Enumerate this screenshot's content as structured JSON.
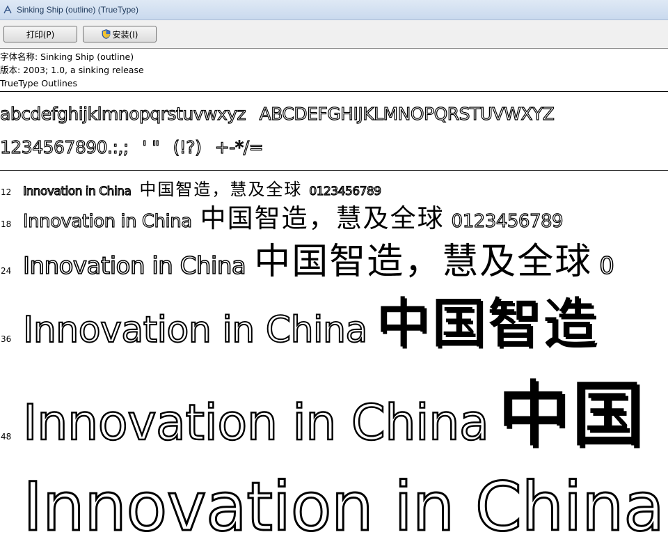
{
  "window": {
    "title": "Sinking Ship (outline) (TrueType)",
    "icon": "font-viewer-icon"
  },
  "toolbar": {
    "print_label": "打印(P)",
    "install_label": "安装(I)",
    "install_icon": "uac-shield-icon"
  },
  "info": {
    "font_name": "字体名称: Sinking Ship (outline)",
    "version": "版本: 2003; 1.0, a sinking release",
    "outline_type": "TrueType Outlines"
  },
  "charset": {
    "lowercase": "abcdefghijklmnopqrstuvwxyz",
    "uppercase": "ABCDEFGHIJKLMNOPQRSTUVWXYZ",
    "digits_punct": "1234567890.:,;",
    "quotes": "' \"",
    "symbols1": "(!?)",
    "symbols2": "+-*/=",
    "empty": ""
  },
  "samples": [
    {
      "size": "12",
      "latin": "Innovation in China",
      "cjk": "中国智造，慧及全球",
      "digits": "0123456789"
    },
    {
      "size": "18",
      "latin": "Innovation in China",
      "cjk": "中国智造，慧及全球",
      "digits": "0123456789"
    },
    {
      "size": "24",
      "latin": "Innovation in China",
      "cjk": "中国智造，慧及全球",
      "digits": "0"
    },
    {
      "size": "36",
      "latin": "Innovation in China",
      "cjk": "中国智造"
    },
    {
      "size": "48",
      "latin": "Innovation in China",
      "cjk": "中国"
    },
    {
      "size": "",
      "latin": "Innovation in China"
    }
  ]
}
